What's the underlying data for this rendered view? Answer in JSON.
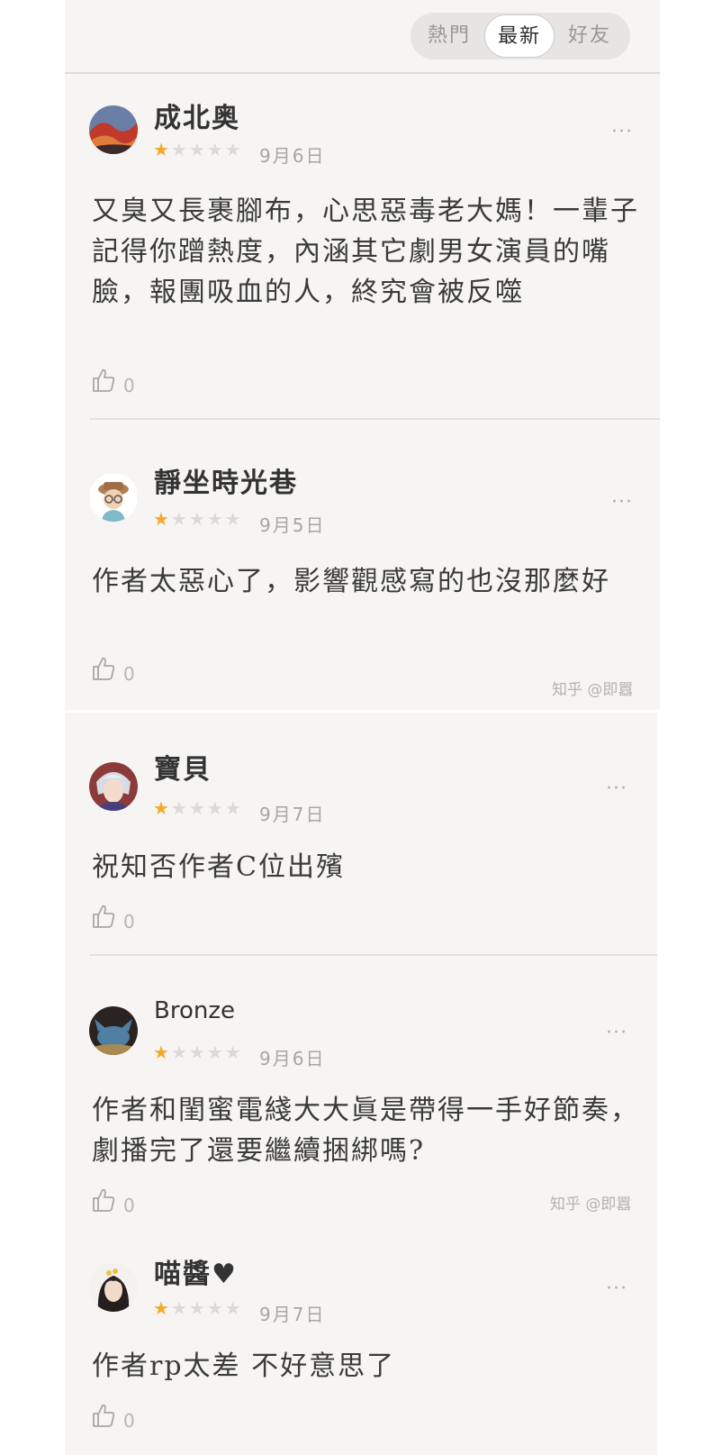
{
  "tabs": [
    {
      "label": "熱門",
      "active": false
    },
    {
      "label": "最新",
      "active": true
    },
    {
      "label": "好友",
      "active": false
    }
  ],
  "star_colors": {
    "filled": "#f3a92a",
    "empty": "#dcdad7"
  },
  "comments": [
    {
      "name": "成北奥",
      "rating": 1,
      "max_rating": 5,
      "date": "9月6日",
      "text": "又臭又長裹腳布，心思惡毒老大媽！一輩子記得你蹭熱度，內涵其它劇男女演員的嘴臉，報團吸血的人，終究會被反噬",
      "likes": "0",
      "more": "···"
    },
    {
      "name": "靜坐時光巷",
      "rating": 1,
      "max_rating": 5,
      "date": "9月5日",
      "text": "作者太惡心了，影響觀感寫的也沒那麼好",
      "likes": "0",
      "more": "···"
    },
    {
      "name": "寶貝",
      "rating": 1,
      "max_rating": 5,
      "date": "9月7日",
      "text": "祝知否作者C位出殯",
      "likes": "0",
      "more": "···"
    },
    {
      "name": "Bronze",
      "rating": 1,
      "max_rating": 5,
      "date": "9月6日",
      "text": "作者和閨蜜電綫大大眞是帶得一手好節奏，劇播完了還要繼續捆綁嗎?",
      "likes": "0",
      "more": "···"
    },
    {
      "name": "喵醬♥",
      "rating": 1,
      "max_rating": 5,
      "date": "9月7日",
      "text": "作者rp太差 不好意思了",
      "likes": "0",
      "more": "···"
    }
  ],
  "watermarks": [
    "知乎 @即囂",
    "知乎 @即囂"
  ]
}
